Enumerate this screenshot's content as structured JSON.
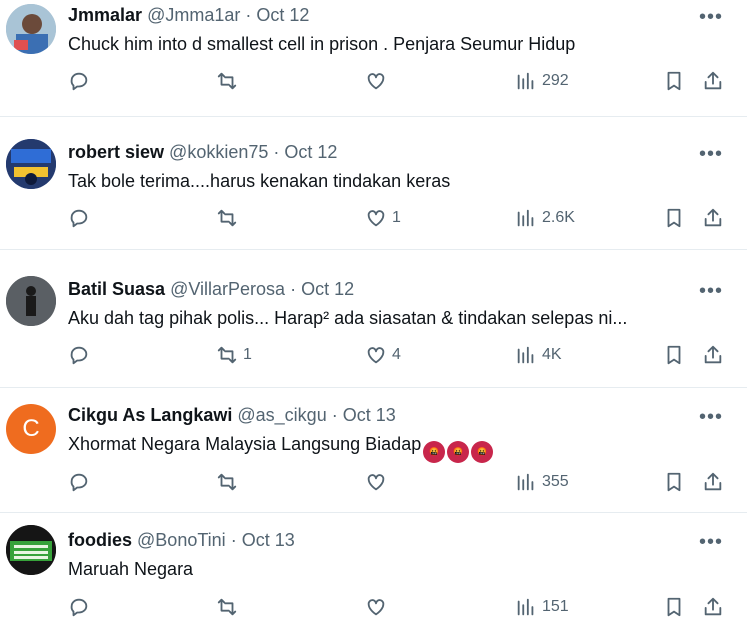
{
  "tweets": [
    {
      "name": "Jmmalar",
      "handle": "@Jmma1ar",
      "dot": "·",
      "date": "Oct 12",
      "text": "Chuck him into d smallest cell in prison . Penjara Seumur Hidup",
      "replies": "",
      "retweets": "",
      "likes": "",
      "views": "292",
      "avatar_color": "#9fb6c8"
    },
    {
      "name": "robert siew",
      "handle": "@kokkien75",
      "dot": "·",
      "date": "Oct 12",
      "text": "Tak bole terima....harus kenakan tindakan keras",
      "replies": "",
      "retweets": "",
      "likes": "1",
      "views": "2.6K",
      "avatar_color": "#1d3f8c"
    },
    {
      "name": "Batil Suasa",
      "handle": "@VillarPerosa",
      "dot": "·",
      "date": "Oct 12",
      "text": "Aku dah tag pihak polis... Harap² ada siasatan & tindakan selepas ni...",
      "replies": "",
      "retweets": "1",
      "likes": "4",
      "views": "4K",
      "avatar_color": "#4a4f54"
    },
    {
      "name": "Cikgu As Langkawi",
      "handle": "@as_cikgu",
      "dot": "·",
      "date": "Oct 13",
      "text": "Xhormat Negara Malaysia Langsung Biadap",
      "replies": "",
      "retweets": "",
      "likes": "",
      "views": "355",
      "avatar_color": "#ef6c1f",
      "avatar_letter": "C",
      "emoji": [
        "🤬",
        "🤬",
        "🤬"
      ]
    },
    {
      "name": "foodies",
      "handle": "@BonoTini",
      "dot": "·",
      "date": "Oct 13",
      "text": "Maruah Negara",
      "replies": "",
      "retweets": "",
      "likes": "",
      "views": "151",
      "avatar_color": "#1d1d1d"
    }
  ],
  "more_label": "•••",
  "icons": {
    "reply": "reply-icon",
    "retweet": "retweet-icon",
    "like": "heart-icon",
    "views": "views-icon",
    "bookmark": "bookmark-icon",
    "share": "share-icon"
  }
}
